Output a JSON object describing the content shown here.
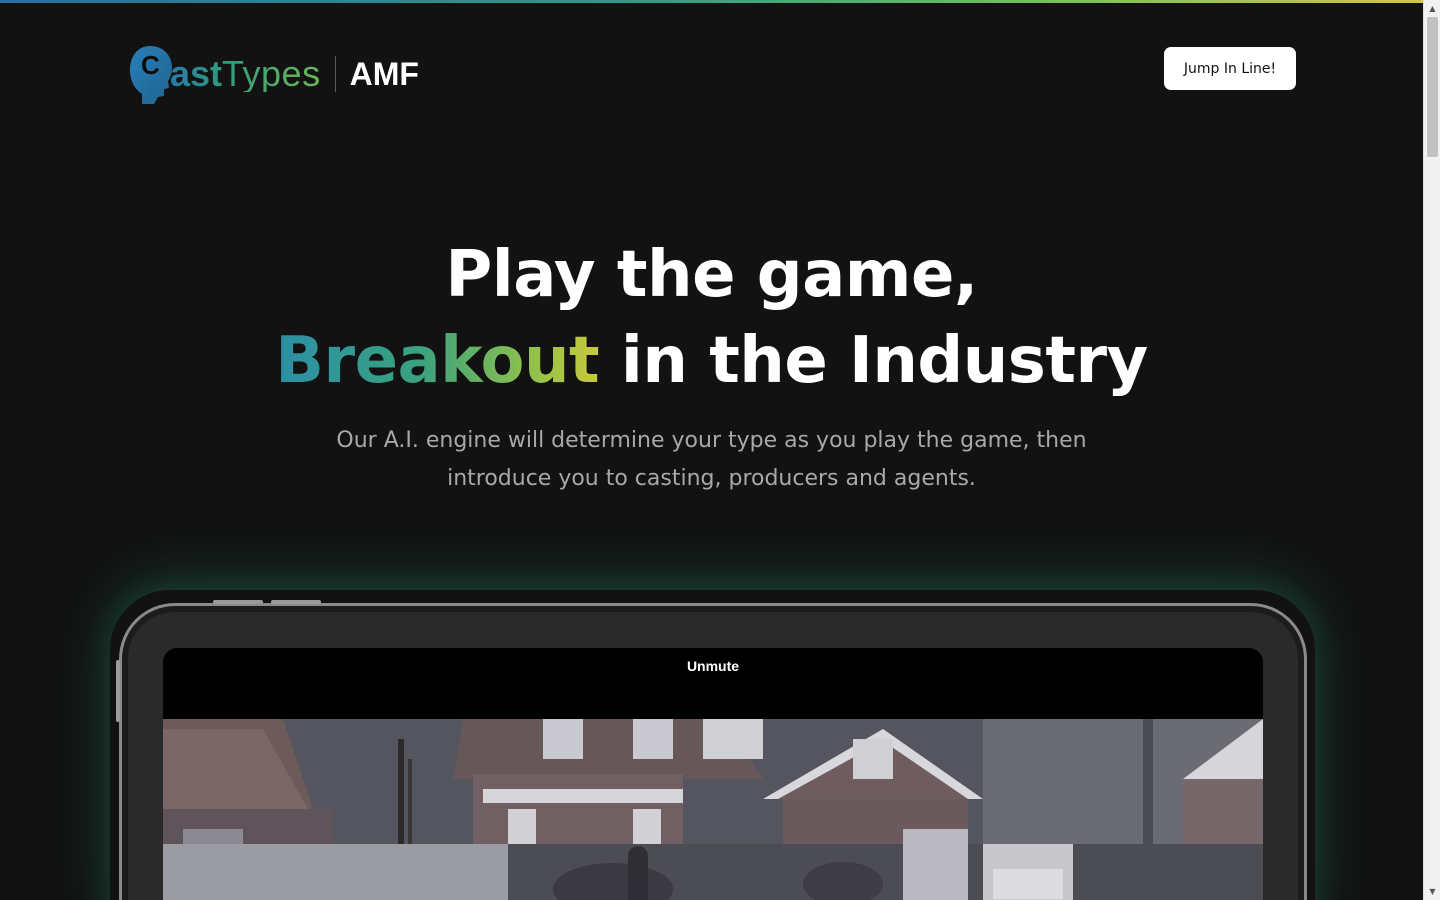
{
  "brand": {
    "logo_initial": "C",
    "logo_bold": "ast",
    "logo_thin": "Types",
    "logo_suffix": "AMF"
  },
  "header": {
    "cta_label": "Jump In Line!"
  },
  "hero": {
    "title_line1": "Play the game,",
    "title_accent": "Breakout",
    "title_line2_rest": " in the Industry",
    "subtitle_line1": "Our A.I. engine will determine your type as you play the game, then",
    "subtitle_line2": "introduce you to casting, producers and agents."
  },
  "video": {
    "unmute_label": "Unmute"
  },
  "colors": {
    "background": "#121212",
    "accent_start": "#2b8fa6",
    "accent_mid": "#3aa27f",
    "accent_end": "#c9c93c",
    "button_bg": "#ffffff"
  },
  "icons": [
    "head-silhouette-icon",
    "scroll-up-arrow-icon",
    "scroll-down-arrow-icon"
  ]
}
